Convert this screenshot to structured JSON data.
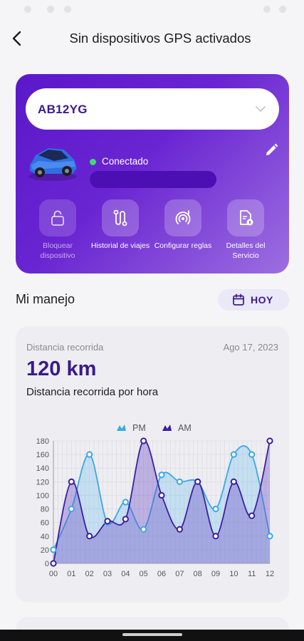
{
  "header": {
    "title": "Sin dispositivos GPS activados"
  },
  "vehicle": {
    "plate": "AB12YG",
    "status": "Conectado"
  },
  "actions": [
    {
      "label": "Bloquear dispositivo",
      "icon": "lock-icon",
      "enabled": false
    },
    {
      "label": "Historial de viajes",
      "icon": "route-icon",
      "enabled": true
    },
    {
      "label": "Configurar reglas",
      "icon": "signal-rules-icon",
      "enabled": true
    },
    {
      "label": "Detalles del Servicio",
      "icon": "document-info-icon",
      "enabled": true
    }
  ],
  "driving": {
    "section_title": "Mi manejo",
    "period_label": "HOY"
  },
  "stats": {
    "label": "Distancia recorrida",
    "date": "Ago 17, 2023",
    "value": "120 km",
    "subtitle": "Distancia recorrida por hora"
  },
  "colors": {
    "primary": "#5b18c9",
    "accent_dark": "#3a1a8c",
    "connected": "#3ddc6f",
    "pm_series": "#3aa8e8",
    "am_series": "#3b1fa0"
  },
  "chart_data": {
    "type": "area",
    "title": "",
    "xlabel": "",
    "ylabel": "",
    "categories": [
      "00",
      "01",
      "02",
      "03",
      "04",
      "05",
      "06",
      "07",
      "08",
      "09",
      "10",
      "11",
      "12"
    ],
    "ylim": [
      0,
      180
    ],
    "yticks": [
      0,
      20,
      40,
      60,
      80,
      100,
      120,
      140,
      160,
      180
    ],
    "grid": true,
    "legend": "top-center",
    "series": [
      {
        "name": "PM",
        "color": "#3aa8e8",
        "points": [
          [
            0,
            20
          ],
          [
            1,
            80
          ],
          [
            2,
            160
          ],
          [
            3,
            60
          ],
          [
            4,
            90
          ],
          [
            5,
            50
          ],
          [
            6,
            130
          ],
          [
            7,
            120
          ],
          [
            8,
            120
          ],
          [
            9,
            80
          ],
          [
            10,
            160
          ],
          [
            11,
            160
          ],
          [
            12,
            40
          ]
        ]
      },
      {
        "name": "AM",
        "color": "#3b1fa0",
        "points": [
          [
            0,
            0
          ],
          [
            1,
            120
          ],
          [
            2,
            40
          ],
          [
            3,
            62
          ],
          [
            4,
            65
          ],
          [
            5,
            180
          ],
          [
            6,
            100
          ],
          [
            7,
            50
          ],
          [
            8,
            120
          ],
          [
            9,
            40
          ],
          [
            10,
            120
          ],
          [
            11,
            70
          ],
          [
            12,
            180
          ]
        ]
      }
    ]
  }
}
